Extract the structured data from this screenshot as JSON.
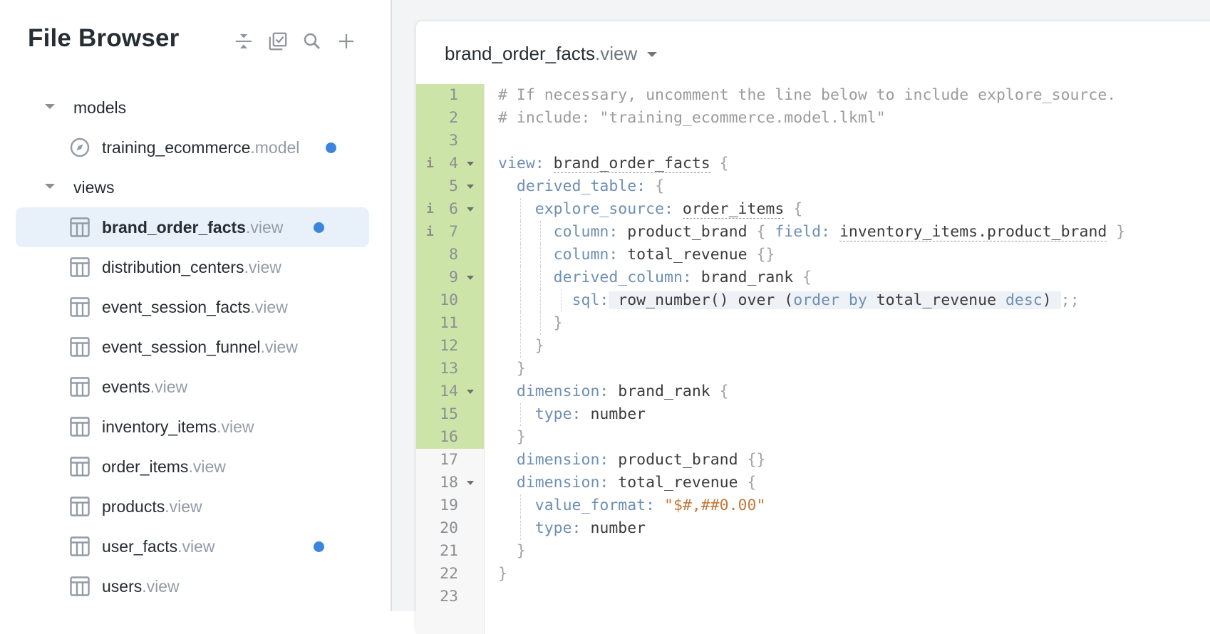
{
  "sidebar": {
    "title": "File Browser",
    "toolbar": [
      {
        "name": "collapse-all-icon",
        "label": "Collapse all"
      },
      {
        "name": "multi-select-icon",
        "label": "Select files"
      },
      {
        "name": "search-icon",
        "label": "Search"
      },
      {
        "name": "plus-icon",
        "label": "Add"
      }
    ],
    "folders": [
      {
        "label": "models",
        "expanded": true,
        "files": [
          {
            "name": "training_ecommerce",
            "ext": ".model",
            "icon": "compass-icon",
            "modified": true,
            "selected": false
          }
        ]
      },
      {
        "label": "views",
        "expanded": true,
        "files": [
          {
            "name": "brand_order_facts",
            "ext": ".view",
            "icon": "table-icon",
            "modified": true,
            "selected": true
          },
          {
            "name": "distribution_centers",
            "ext": ".view",
            "icon": "table-icon",
            "modified": false,
            "selected": false
          },
          {
            "name": "event_session_facts",
            "ext": ".view",
            "icon": "table-icon",
            "modified": false,
            "selected": false
          },
          {
            "name": "event_session_funnel",
            "ext": ".view",
            "icon": "table-icon",
            "modified": false,
            "selected": false
          },
          {
            "name": "events",
            "ext": ".view",
            "icon": "table-icon",
            "modified": false,
            "selected": false
          },
          {
            "name": "inventory_items",
            "ext": ".view",
            "icon": "table-icon",
            "modified": false,
            "selected": false
          },
          {
            "name": "order_items",
            "ext": ".view",
            "icon": "table-icon",
            "modified": false,
            "selected": false
          },
          {
            "name": "products",
            "ext": ".view",
            "icon": "table-icon",
            "modified": false,
            "selected": false
          },
          {
            "name": "user_facts",
            "ext": ".view",
            "icon": "table-icon",
            "modified": true,
            "selected": false
          },
          {
            "name": "users",
            "ext": ".view",
            "icon": "table-icon",
            "modified": false,
            "selected": false
          }
        ]
      }
    ]
  },
  "editor": {
    "file_name": "brand_order_facts",
    "file_ext": ".view",
    "colors": {
      "changed_gutter": "#cde4a9",
      "modified_dot": "#3b86dc",
      "keyword": "#6e8fb4",
      "string": "#c27a3a",
      "comment": "#9b9b9b"
    },
    "lines": [
      {
        "n": "1",
        "changed": true,
        "info": false,
        "fold": false,
        "indent": 0,
        "tokens": [
          [
            "comment",
            "# If necessary, uncomment the line below to include explore_source."
          ]
        ]
      },
      {
        "n": "2",
        "changed": true,
        "info": false,
        "fold": false,
        "indent": 0,
        "tokens": [
          [
            "comment",
            "# include: \"training_ecommerce.model.lkml\""
          ]
        ]
      },
      {
        "n": "3",
        "changed": true,
        "info": false,
        "fold": false,
        "indent": 0,
        "tokens": []
      },
      {
        "n": "4",
        "changed": true,
        "info": true,
        "fold": true,
        "indent": 0,
        "tokens": [
          [
            "key",
            "view: "
          ],
          [
            "ref",
            "brand_order_facts"
          ],
          [
            "brace",
            " {"
          ]
        ]
      },
      {
        "n": "5",
        "changed": true,
        "info": false,
        "fold": true,
        "indent": 1,
        "tokens": [
          [
            "key",
            "derived_table: "
          ],
          [
            "brace",
            "{"
          ]
        ]
      },
      {
        "n": "6",
        "changed": true,
        "info": true,
        "fold": true,
        "indent": 2,
        "tokens": [
          [
            "key",
            "explore_source: "
          ],
          [
            "ref",
            "order_items"
          ],
          [
            "brace",
            " {"
          ]
        ]
      },
      {
        "n": "7",
        "changed": true,
        "info": true,
        "fold": false,
        "indent": 3,
        "tokens": [
          [
            "key",
            "column: "
          ],
          [
            "val",
            "product_brand "
          ],
          [
            "brace",
            "{ "
          ],
          [
            "key",
            "field: "
          ],
          [
            "ref",
            "inventory_items.product_brand"
          ],
          [
            "brace",
            " }"
          ]
        ]
      },
      {
        "n": "8",
        "changed": true,
        "info": false,
        "fold": false,
        "indent": 3,
        "tokens": [
          [
            "key",
            "column: "
          ],
          [
            "val",
            "total_revenue "
          ],
          [
            "brace",
            "{}"
          ]
        ]
      },
      {
        "n": "9",
        "changed": true,
        "info": false,
        "fold": true,
        "indent": 3,
        "tokens": [
          [
            "key",
            "derived_column: "
          ],
          [
            "val",
            "brand_rank "
          ],
          [
            "brace",
            "{"
          ]
        ]
      },
      {
        "n": "10",
        "changed": true,
        "info": false,
        "fold": false,
        "indent": 4,
        "tokens": [
          [
            "key",
            "sql:"
          ],
          [
            "sql",
            " row_number() over ("
          ],
          [
            "sqlkw",
            "order by"
          ],
          [
            "sql",
            " total_revenue "
          ],
          [
            "sqlkw",
            "desc"
          ],
          [
            "sql",
            ") "
          ],
          [
            "brace",
            ";;"
          ]
        ]
      },
      {
        "n": "11",
        "changed": true,
        "info": false,
        "fold": false,
        "indent": 3,
        "tokens": [
          [
            "brace",
            "}"
          ]
        ]
      },
      {
        "n": "12",
        "changed": true,
        "info": false,
        "fold": false,
        "indent": 2,
        "tokens": [
          [
            "brace",
            "}"
          ]
        ]
      },
      {
        "n": "13",
        "changed": true,
        "info": false,
        "fold": false,
        "indent": 1,
        "tokens": [
          [
            "brace",
            "}"
          ]
        ]
      },
      {
        "n": "14",
        "changed": true,
        "info": false,
        "fold": true,
        "indent": 1,
        "tokens": [
          [
            "key",
            "dimension: "
          ],
          [
            "val",
            "brand_rank "
          ],
          [
            "brace",
            "{"
          ]
        ]
      },
      {
        "n": "15",
        "changed": true,
        "info": false,
        "fold": false,
        "indent": 2,
        "tokens": [
          [
            "key",
            "type: "
          ],
          [
            "val",
            "number"
          ]
        ]
      },
      {
        "n": "16",
        "changed": true,
        "info": false,
        "fold": false,
        "indent": 1,
        "tokens": [
          [
            "brace",
            "}"
          ]
        ]
      },
      {
        "n": "17",
        "changed": false,
        "info": false,
        "fold": false,
        "indent": 1,
        "tokens": [
          [
            "key",
            "dimension: "
          ],
          [
            "val",
            "product_brand "
          ],
          [
            "brace",
            "{}"
          ]
        ]
      },
      {
        "n": "18",
        "changed": false,
        "info": false,
        "fold": true,
        "indent": 1,
        "tokens": [
          [
            "key",
            "dimension: "
          ],
          [
            "val",
            "total_revenue "
          ],
          [
            "brace",
            "{"
          ]
        ]
      },
      {
        "n": "19",
        "changed": false,
        "info": false,
        "fold": false,
        "indent": 2,
        "tokens": [
          [
            "key",
            "value_format: "
          ],
          [
            "str",
            "\"$#,##0.00\""
          ]
        ]
      },
      {
        "n": "20",
        "changed": false,
        "info": false,
        "fold": false,
        "indent": 2,
        "tokens": [
          [
            "key",
            "type: "
          ],
          [
            "val",
            "number"
          ]
        ]
      },
      {
        "n": "21",
        "changed": false,
        "info": false,
        "fold": false,
        "indent": 1,
        "tokens": [
          [
            "brace",
            "}"
          ]
        ]
      },
      {
        "n": "22",
        "changed": false,
        "info": false,
        "fold": false,
        "indent": 0,
        "tokens": [
          [
            "brace",
            "}"
          ]
        ]
      },
      {
        "n": "23",
        "changed": false,
        "info": false,
        "fold": false,
        "indent": 0,
        "tokens": []
      }
    ]
  }
}
